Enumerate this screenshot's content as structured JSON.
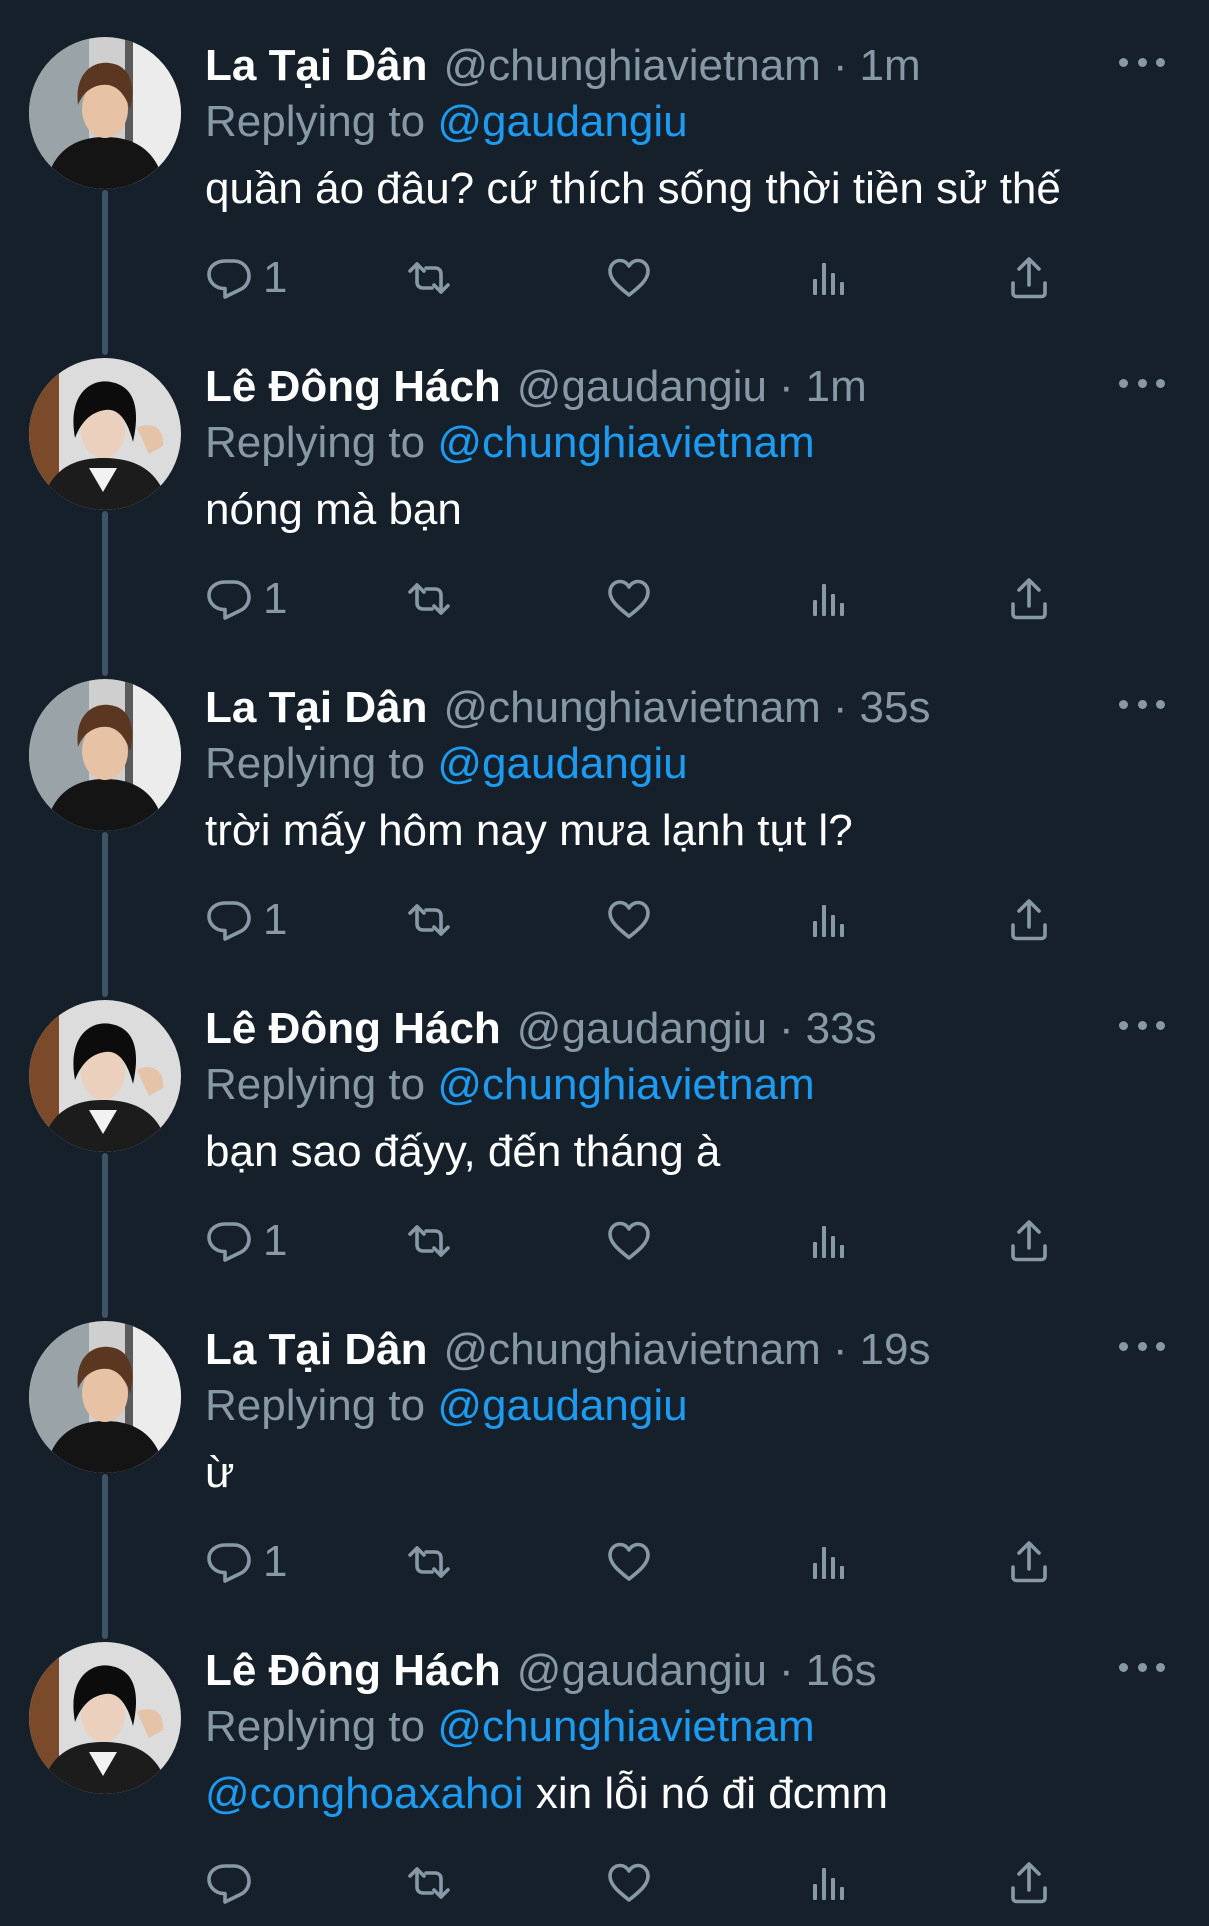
{
  "tweets": [
    {
      "author": "La Tại Dân",
      "handle": "@chunghiavietnam",
      "separator": "·",
      "time": "1m",
      "replying_prefix": "Replying to",
      "replying_to": "@gaudangiu",
      "text_mention": "",
      "text": "quần áo đâu? cứ thích sống thời tiền sử thế",
      "reply_count": "1",
      "avatar": "avatar-brown-hair"
    },
    {
      "author": "Lê Đông Hách",
      "handle": "@gaudangiu",
      "separator": "·",
      "time": "1m",
      "replying_prefix": "Replying to",
      "replying_to": "@chunghiavietnam",
      "text_mention": "",
      "text": "nóng mà bạn",
      "reply_count": "1",
      "avatar": "avatar-black-hair"
    },
    {
      "author": "La Tại Dân",
      "handle": "@chunghiavietnam",
      "separator": "·",
      "time": "35s",
      "replying_prefix": "Replying to",
      "replying_to": "@gaudangiu",
      "text_mention": "",
      "text": "trời mấy hôm nay mưa lạnh tụt l?",
      "reply_count": "1",
      "avatar": "avatar-brown-hair"
    },
    {
      "author": "Lê Đông Hách",
      "handle": "@gaudangiu",
      "separator": "·",
      "time": "33s",
      "replying_prefix": "Replying to",
      "replying_to": "@chunghiavietnam",
      "text_mention": "",
      "text": "bạn sao đấyy, đến tháng à",
      "reply_count": "1",
      "avatar": "avatar-black-hair"
    },
    {
      "author": "La Tại Dân",
      "handle": "@chunghiavietnam",
      "separator": "·",
      "time": "19s",
      "replying_prefix": "Replying to",
      "replying_to": "@gaudangiu",
      "text_mention": "",
      "text": "ừ",
      "reply_count": "1",
      "avatar": "avatar-brown-hair"
    },
    {
      "author": "Lê Đông Hách",
      "handle": "@gaudangiu",
      "separator": "·",
      "time": "16s",
      "replying_prefix": "Replying to",
      "replying_to": "@chunghiavietnam",
      "text_mention": "@conghoaxahoi",
      "text": " xin lỗi nó đi đcmm",
      "reply_count": "",
      "avatar": "avatar-black-hair"
    }
  ],
  "icons": {
    "reply": "reply-icon",
    "retweet": "retweet-icon",
    "like": "heart-icon",
    "views": "views-icon",
    "share": "share-icon",
    "more": "more-icon"
  },
  "colors": {
    "background": "#15202b",
    "secondary_text": "#8899a6",
    "link": "#1d9bf0",
    "thread_line": "#3d5466"
  }
}
